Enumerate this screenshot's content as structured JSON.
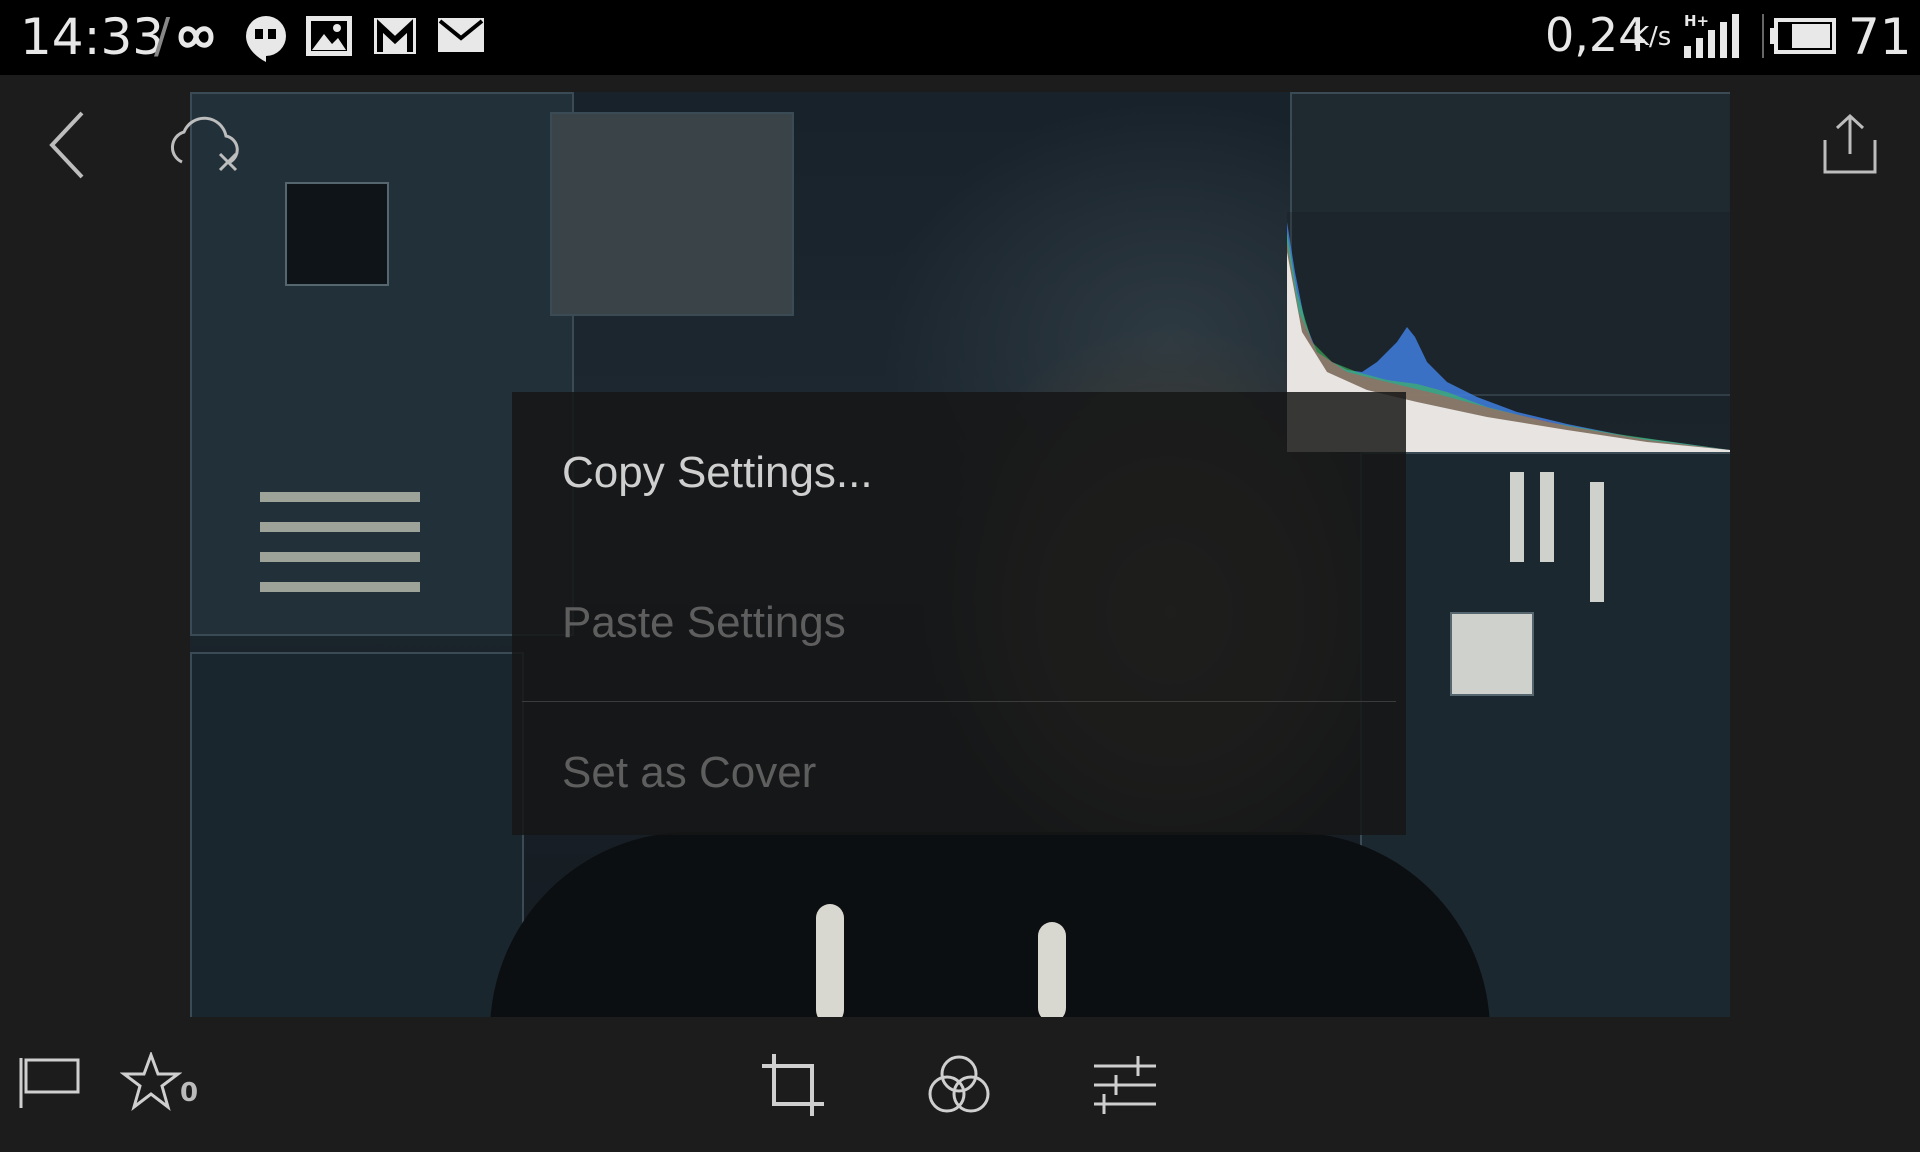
{
  "status_bar": {
    "time": "14:33",
    "separator": "/",
    "notification_icons": [
      "infinity-icon",
      "hangouts-icon",
      "gallery-icon",
      "gmail-icon",
      "email-icon"
    ],
    "network_speed": "0,24",
    "network_speed_unit": "K/s",
    "network_type": "H+",
    "battery_level": "71"
  },
  "top_bar": {
    "back_icon": "chevron-left-icon",
    "sync_icon": "cloud-off-icon",
    "share_icon": "share-icon"
  },
  "histogram": {
    "colors": [
      "#e04545",
      "#3fbf5a",
      "#3f7fe0",
      "#ffffff",
      "#e0d040"
    ]
  },
  "context_menu": {
    "items": [
      {
        "label": "Copy Settings...",
        "enabled": true
      },
      {
        "label": "Paste Settings",
        "enabled": false
      },
      {
        "label": "Set as Cover",
        "enabled": false
      }
    ]
  },
  "bottom_toolbar": {
    "flag_icon": "flag-icon",
    "rating_icon": "star-icon",
    "rating_value": "0",
    "tools": [
      "crop-icon",
      "presets-icon",
      "adjust-icon"
    ]
  },
  "colors": {
    "background": "#1c1c1c",
    "status_bar": "#000000",
    "menu_text_enabled": "#cfcfcf",
    "menu_text_disabled": "#5e5e5e"
  }
}
